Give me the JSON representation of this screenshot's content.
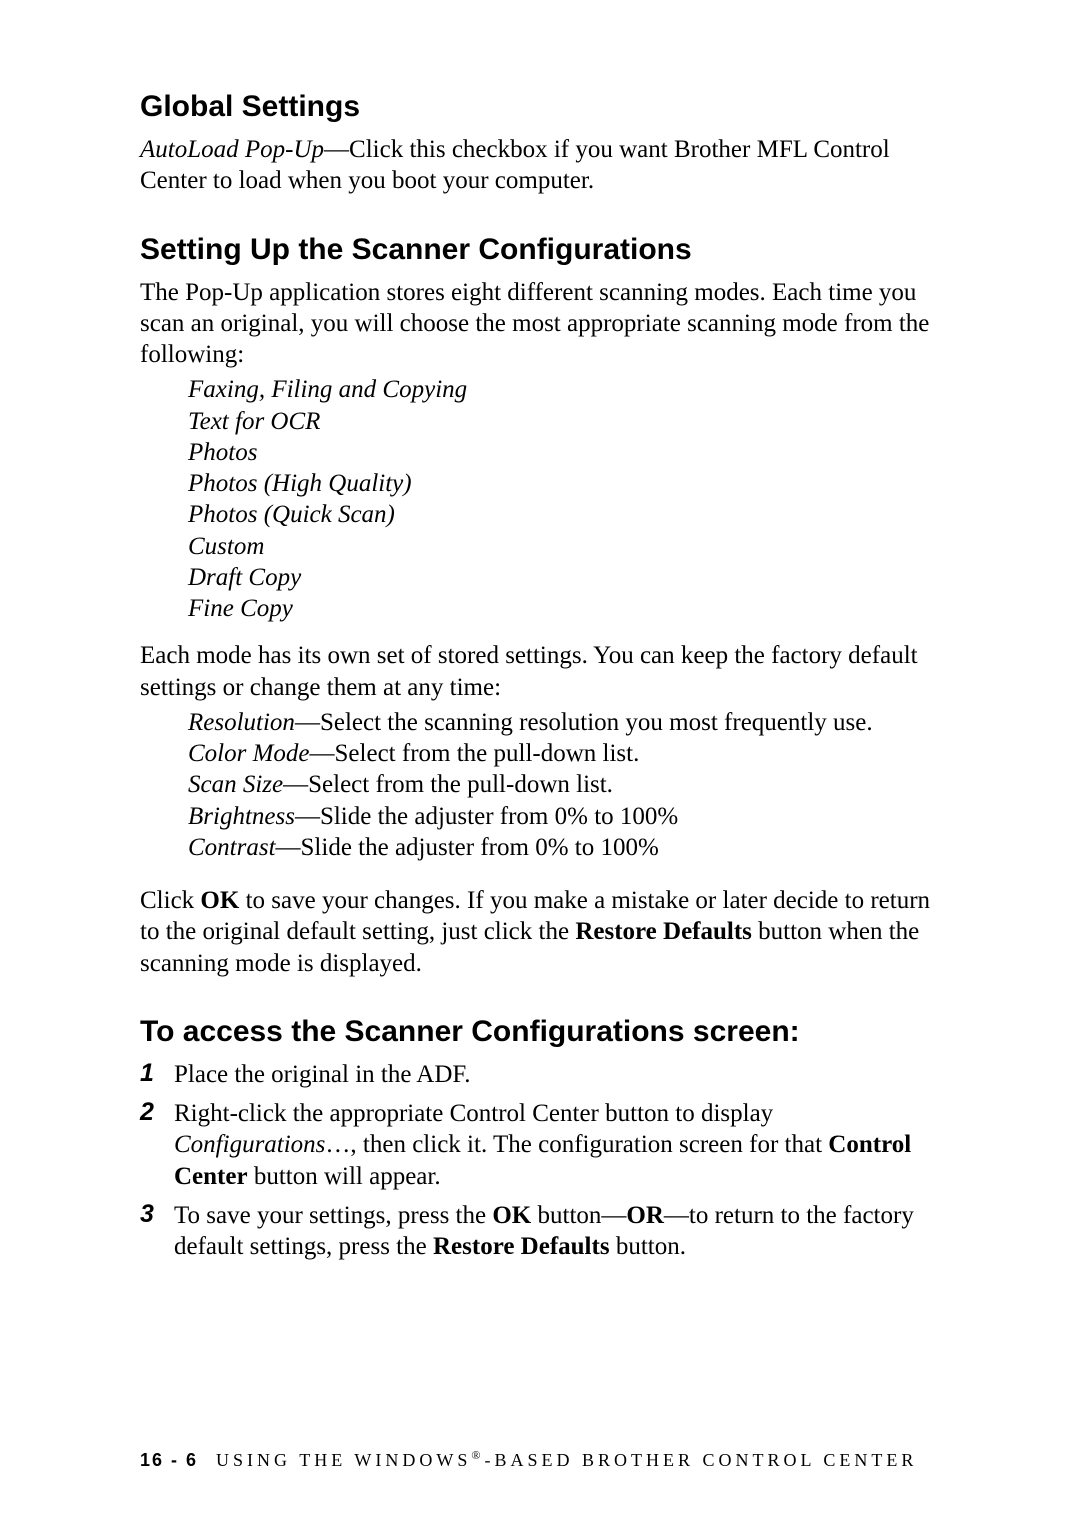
{
  "section1": {
    "heading": "Global Settings",
    "para_italic": "AutoLoad Pop-Up",
    "para_rest": "—Click this checkbox if you want Brother MFL Control Center to load when you boot your computer."
  },
  "section2": {
    "heading": "Setting Up the Scanner Configurations",
    "intro": "The Pop-Up application stores eight different scanning modes. Each time you scan an original, you will choose the most appropriate scanning mode from the following:",
    "modes": [
      "Faxing, Filing and Copying",
      "Text for OCR",
      "Photos",
      "Photos (High Quality)",
      "Photos (Quick Scan)",
      "Custom",
      "Draft Copy",
      "Fine Copy"
    ],
    "para2": "Each mode has its own set of stored settings. You can keep the factory default settings or change them at any time:",
    "settings": [
      {
        "label": "Resolution",
        "desc": "—Select the scanning resolution you most frequently use."
      },
      {
        "label": "Color Mode",
        "desc": "—Select from the pull-down list."
      },
      {
        "label": "Scan Size",
        "desc": "—Select from the pull-down list."
      },
      {
        "label": "Brightness",
        "desc": "—Slide the adjuster from 0% to 100%"
      },
      {
        "label": "Contrast",
        "desc": "—Slide the adjuster from 0% to 100%"
      }
    ],
    "para3_a": "Click ",
    "para3_b": "OK",
    "para3_c": " to save your changes. If you make a mistake or later decide to return to the original default setting, just click the ",
    "para3_d": "Restore Defaults",
    "para3_e": " button when the scanning mode is displayed."
  },
  "section3": {
    "heading": "To access the Scanner Configurations screen:",
    "steps": {
      "s1_num": "1",
      "s1_text": "Place the original in the ADF.",
      "s2_num": "2",
      "s2_a": "Right-click the appropriate Control Center button to display ",
      "s2_b": "Configurations",
      "s2_c": "…, then click it. The configuration screen for that ",
      "s2_d": "Control Center",
      "s2_e": " button will appear.",
      "s3_num": "3",
      "s3_a": "To save your settings, press the ",
      "s3_b": "OK",
      "s3_c": " button—",
      "s3_d": "OR",
      "s3_e": "—to return to the factory default settings, press the ",
      "s3_f": "Restore Defaults",
      "s3_g": " button."
    }
  },
  "footer": {
    "page": "16 - 6",
    "title_a": "USING THE WINDOWS",
    "title_reg": "®",
    "title_b": "-BASED BROTHER CONTROL CENTER"
  }
}
